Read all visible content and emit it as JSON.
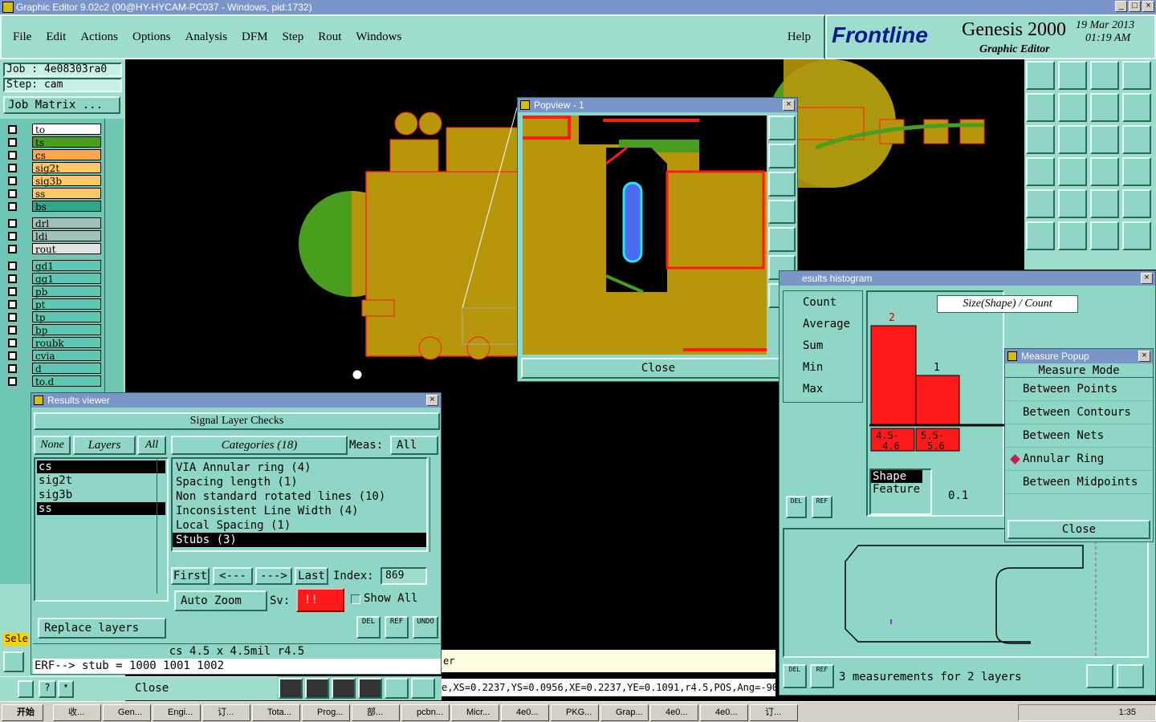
{
  "window_title": "Graphic Editor 9.02c2 (00@HY-HYCAM-PC037 - Windows, pid:1732)",
  "menu": [
    "File",
    "Edit",
    "Actions",
    "Options",
    "Analysis",
    "DFM",
    "Step",
    "Rout",
    "Windows"
  ],
  "help": "Help",
  "brand": {
    "logo": "Frontline",
    "product": "Genesis 2000",
    "sub": "Graphic Editor",
    "date": "19 Mar 2013",
    "time": "01:19 AM"
  },
  "job": {
    "job": "Job : 4e08303ra0",
    "step": "Step: cam",
    "matrix": "Job Matrix ..."
  },
  "layers": [
    "to",
    "ts",
    "cs",
    "sig2t",
    "sig3b",
    "ss",
    "bs",
    "drl",
    "ldi",
    "rout",
    "gd1",
    "gg1",
    "pb",
    "pt",
    "tp",
    "bp",
    "roubk",
    "cvia",
    "d",
    "to.d"
  ],
  "popview": {
    "title": "Popview - 1",
    "close": "Close"
  },
  "results": {
    "title": "Results viewer",
    "header": "Signal Layer Checks",
    "none": "None",
    "layers_btn": "Layers",
    "all": "All",
    "categories_btn": "Categories (18)",
    "meas_label": "Meas:",
    "meas_value": "All",
    "layer_list": [
      "cs",
      "sig2t",
      "sig3b",
      "ss"
    ],
    "categories": [
      "VIA Annular ring (4)",
      "Spacing length (1)",
      "Non standard rotated lines (10)",
      "Inconsistent Line Width (4)",
      "Local Spacing (1)",
      "Stubs (3)"
    ],
    "first": "First",
    "prev": "<---",
    "next": "--->",
    "last": "Last",
    "index_label": "Index:",
    "index_value": "869",
    "autozoom": "Auto Zoom",
    "sv": "Sv:",
    "sv_value": "!!",
    "show_all": "Show All",
    "replace": "Replace layers",
    "del": "DEL",
    "ref": "REF",
    "undo": "UNDO",
    "info": "cs 4.5 x 4.5mil  r4.5",
    "erf": "ERF--> stub = 1000 1001 1002",
    "close": "Close"
  },
  "histogram": {
    "title": "esults histogram",
    "stats": [
      "Count",
      "Average",
      "Sum",
      "Min",
      "Max"
    ],
    "chart_title": "Size(Shape) / Count",
    "bars": [
      {
        "label": "4.5-4.6",
        "value": 2
      },
      {
        "label": "5.5-5.6",
        "value": 1
      }
    ],
    "bin_label1": "4.5-",
    "bin_label1b": "4.6",
    "bin_label2": "5.5-",
    "bin_label2b": "5.6",
    "type_list": [
      "Shape",
      "Feature"
    ],
    "step_value": "0.1",
    "status": "3 measurements for 2 layers"
  },
  "measure": {
    "title": "Measure Popup",
    "mode": "Measure Mode",
    "items": [
      "Between Points",
      "Between Contours",
      "Between Nets",
      "Annular Ring",
      "Between Midpoints"
    ],
    "selected": "Annular Ring",
    "close": "Close"
  },
  "status_bar": {
    "text": "e,XS=0.2237,YS=0.0956,XE=0.2237,YE=0.1091,r4.5,POS,Ang=-90",
    "hint": "er",
    "sel": "Sele"
  },
  "taskbar": {
    "start": "开始",
    "items": [
      "收...",
      "Gen...",
      "Engi...",
      "订...",
      "Tota...",
      "Prog...",
      "部...",
      "pcbn...",
      "Micr...",
      "4e0...",
      "PKG...",
      "Grap...",
      "4e0...",
      "4e0...",
      "订..."
    ],
    "clock": "1:35"
  },
  "colors": {
    "teal": "#8fd6c6",
    "copper": "#b8960c",
    "green": "#4a9e1e",
    "red": "#ff1a1a"
  }
}
